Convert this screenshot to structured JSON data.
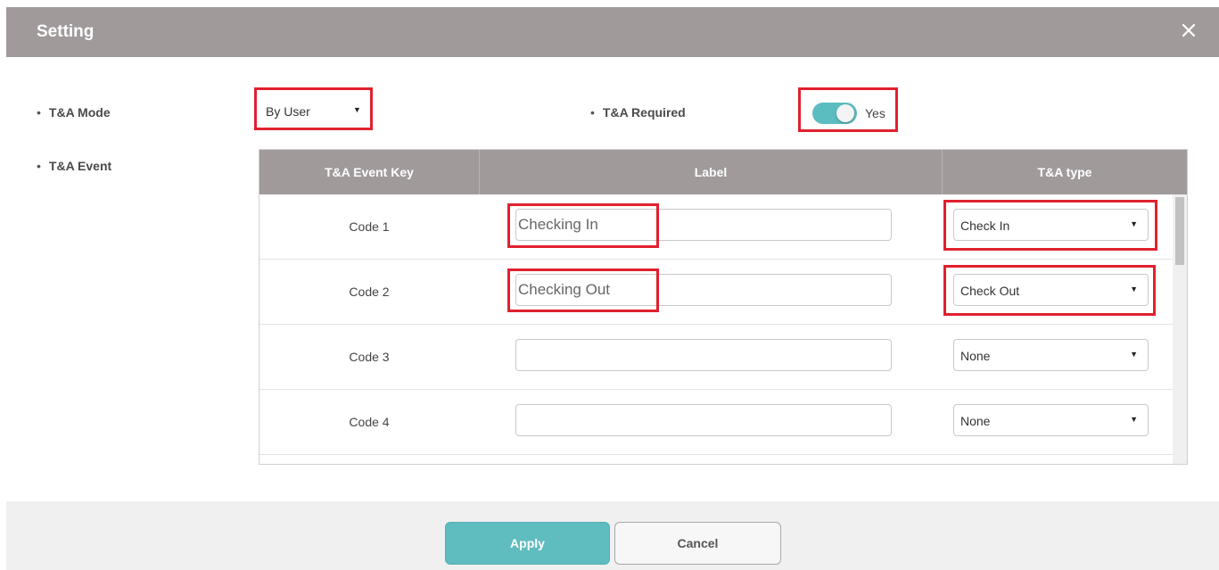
{
  "dialog": {
    "title": "Setting"
  },
  "mode": {
    "label": "T&A Mode",
    "value": "By User"
  },
  "required": {
    "label": "T&A Required",
    "value_label": "Yes",
    "enabled": true
  },
  "event": {
    "label": "T&A Event"
  },
  "table": {
    "columns": [
      "T&A Event Key",
      "Label",
      "T&A type"
    ],
    "rows": [
      {
        "code": "Code 1",
        "label": "Checking In",
        "type": "Check In"
      },
      {
        "code": "Code 2",
        "label": "Checking Out",
        "type": "Check Out"
      },
      {
        "code": "Code 3",
        "label": "",
        "type": "None"
      },
      {
        "code": "Code 4",
        "label": "",
        "type": "None"
      }
    ]
  },
  "buttons": {
    "apply": "Apply",
    "cancel": "Cancel"
  },
  "colors": {
    "header": "#a09a9b",
    "accent": "#5fbcbf",
    "highlight": "#e0212f"
  }
}
